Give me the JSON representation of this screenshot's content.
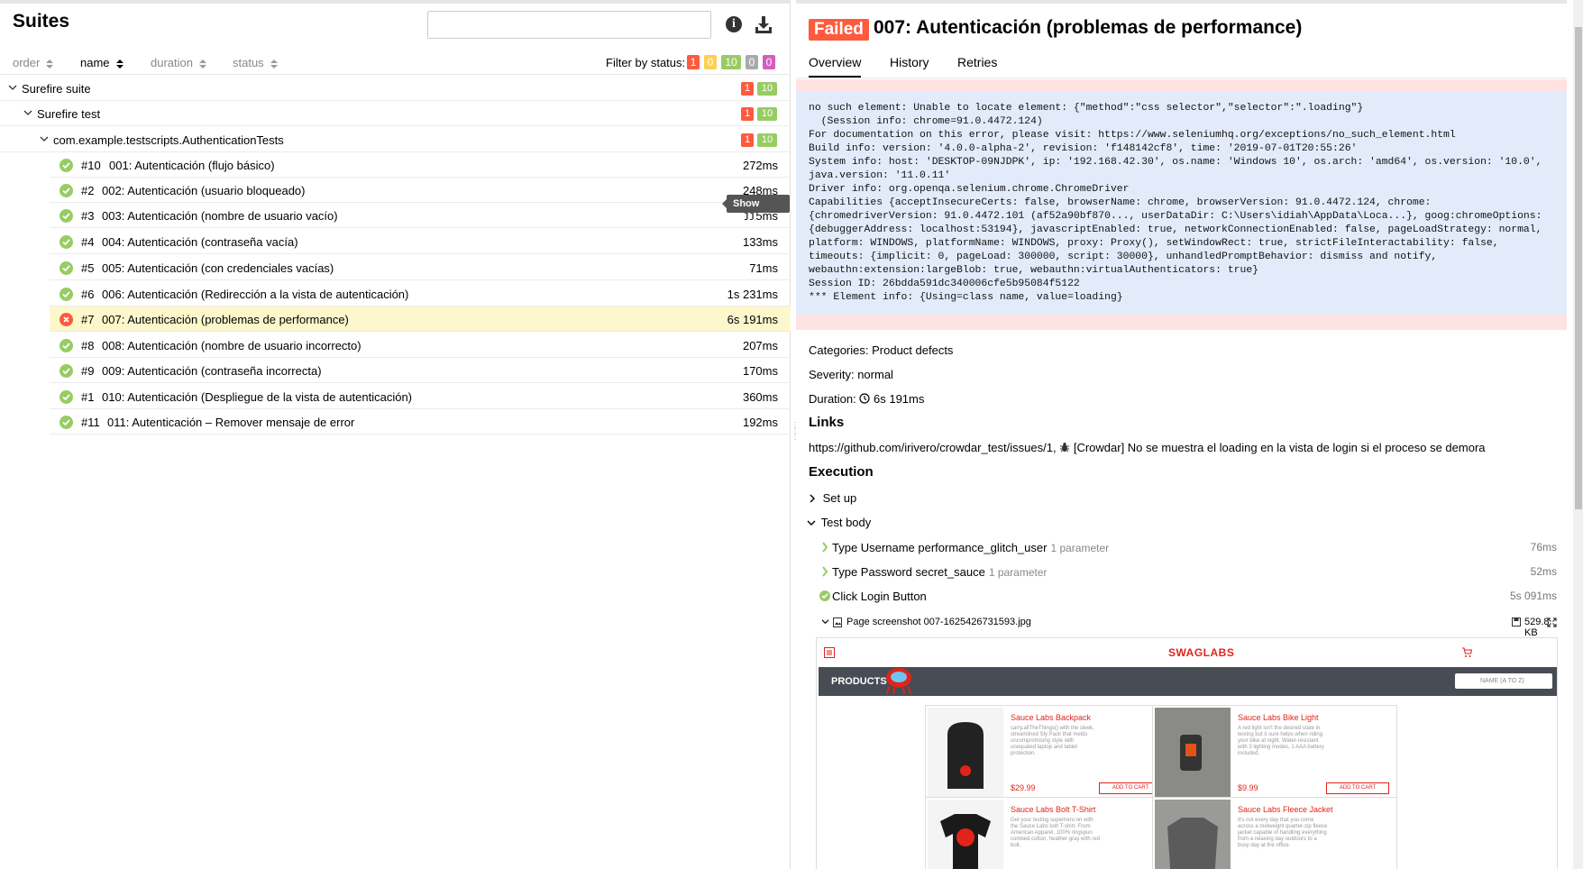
{
  "suites_panel": {
    "title": "Suites",
    "search_placeholder": "",
    "sort": [
      {
        "label": "order"
      },
      {
        "label": "name"
      },
      {
        "label": "duration"
      },
      {
        "label": "status"
      }
    ],
    "filter_label": "Filter by status:",
    "filter_badges": [
      {
        "count": "1",
        "color": "#fd5a3e"
      },
      {
        "count": "0",
        "color": "#ffd050"
      },
      {
        "count": "10",
        "color": "#97cc64"
      },
      {
        "count": "0",
        "color": "#aaaaaa"
      },
      {
        "count": "0",
        "color": "#d35ebe"
      }
    ],
    "tree": [
      {
        "label": "Surefire suite",
        "failed": "1",
        "passed": "10"
      },
      {
        "label": "Surefire test",
        "failed": "1",
        "passed": "10"
      },
      {
        "label": "com.example.testscripts.AuthenticationTests",
        "failed": "1",
        "passed": "10"
      }
    ],
    "tests": [
      {
        "num": "#10",
        "name": "001: Autenticación (flujo básico)",
        "duration": "272ms",
        "status": "passed"
      },
      {
        "num": "#2",
        "name": "002: Autenticación (usuario bloqueado)",
        "duration": "248ms",
        "status": "passed"
      },
      {
        "num": "#3",
        "name": "003: Autenticación (nombre de usuario vacío)",
        "duration": "115ms",
        "status": "passed"
      },
      {
        "num": "#4",
        "name": "004: Autenticación (contraseña vacía)",
        "duration": "133ms",
        "status": "passed"
      },
      {
        "num": "#5",
        "name": "005: Autenticación (con credenciales vacías)",
        "duration": "71ms",
        "status": "passed"
      },
      {
        "num": "#6",
        "name": "006: Autenticación (Redirección a la vista de autenticación)",
        "duration": "1s 231ms",
        "status": "passed"
      },
      {
        "num": "#7",
        "name": "007: Autenticación (problemas de performance)",
        "duration": "6s 191ms",
        "status": "failed"
      },
      {
        "num": "#8",
        "name": "008: Autenticación (nombre de usuario incorrecto)",
        "duration": "207ms",
        "status": "passed"
      },
      {
        "num": "#9",
        "name": "009: Autenticación (contraseña incorrecta)",
        "duration": "170ms",
        "status": "passed"
      },
      {
        "num": "#1",
        "name": "010: Autenticación (Despliegue de la vista de autenticación)",
        "duration": "360ms",
        "status": "passed"
      },
      {
        "num": "#11",
        "name": "011: Autenticación – Remover mensaje de error",
        "duration": "192ms",
        "status": "passed"
      }
    ],
    "tooltip": "Show trace"
  },
  "detail": {
    "status": "Failed",
    "title": "007: Autenticación (problemas de performance)",
    "tabs": [
      "Overview",
      "History",
      "Retries"
    ],
    "trace": "no such element: Unable to locate element: {\"method\":\"css selector\",\"selector\":\".loading\"}\n  (Session info: chrome=91.0.4472.124)\nFor documentation on this error, please visit: https://www.seleniumhq.org/exceptions/no_such_element.html\nBuild info: version: '4.0.0-alpha-2', revision: 'f148142cf8', time: '2019-07-01T20:55:26'\nSystem info: host: 'DESKTOP-09NJDPK', ip: '192.168.42.30', os.name: 'Windows 10', os.arch: 'amd64', os.version: '10.0',\njava.version: '11.0.11'\nDriver info: org.openqa.selenium.chrome.ChromeDriver\nCapabilities {acceptInsecureCerts: false, browserName: chrome, browserVersion: 91.0.4472.124, chrome:\n{chromedriverVersion: 91.0.4472.101 (af52a90bf870..., userDataDir: C:\\Users\\idiah\\AppData\\Loca...}, goog:chromeOptions:\n{debuggerAddress: localhost:53194}, javascriptEnabled: true, networkConnectionEnabled: false, pageLoadStrategy: normal,\nplatform: WINDOWS, platformName: WINDOWS, proxy: Proxy(), setWindowRect: true, strictFileInteractability: false,\ntimeouts: {implicit: 0, pageLoad: 300000, script: 30000}, unhandledPromptBehavior: dismiss and notify,\nwebauthn:extension:largeBlob: true, webauthn:virtualAuthenticators: true}\nSession ID: 26bdda591dc340006cfe5b95084f5122\n*** Element info: {Using=class name, value=loading}",
    "categories_label": "Categories:",
    "categories_value": "Product defects",
    "severity_label": "Severity:",
    "severity_value": "normal",
    "duration_label": "Duration:",
    "duration_value": "6s 191ms",
    "links_heading": "Links",
    "link_url": "https://github.com/irivero/crowdar_test/issues/1",
    "link_sep": ",",
    "link_issue": "[Crowdar] No se muestra el loading en la vista de login si el proceso se demora",
    "execution_heading": "Execution",
    "setup_label": "Set up",
    "testbody_label": "Test body",
    "steps": [
      {
        "name": "Type Username performance_glitch_user",
        "param": "1 parameter",
        "duration": "76ms"
      },
      {
        "name": "Type Password secret_sauce",
        "param": "1 parameter",
        "duration": "52ms"
      },
      {
        "name": "Click Login Button",
        "param": "",
        "duration": "5s 091ms"
      }
    ],
    "attachment_name": "Page screenshot 007-1625426731593.jpg",
    "attachment_size": "529.8 KB"
  },
  "screenshot": {
    "logo": "SWAGLABS",
    "products_label": "PRODUCTS",
    "sort_label": "NAME (A TO Z)",
    "items": [
      {
        "title": "Sauce Labs Backpack",
        "desc": "carry.allTheThings() with the sleek, streamlined Sly Pack that melds uncompromising style with unequaled laptop and tablet protection.",
        "price": "$29.99",
        "button": "ADD TO CART"
      },
      {
        "title": "Sauce Labs Bike Light",
        "desc": "A red light isn't the desired state in testing but it sure helps when riding your bike at night. Water-resistant with 3 lighting modes, 1 AAA battery included.",
        "price": "$9.99",
        "button": "ADD TO CART"
      },
      {
        "title": "Sauce Labs Bolt T-Shirt",
        "desc": "Get your testing superhero on with the Sauce Labs bolt T-shirt. From American Apparel, 100% ringspun combed cotton, heather gray with red bolt.",
        "price": "",
        "button": ""
      },
      {
        "title": "Sauce Labs Fleece Jacket",
        "desc": "It's not every day that you come across a midweight quarter-zip fleece jacket capable of handling everything from a relaxing day outdoors to a busy day at the office.",
        "price": "",
        "button": ""
      }
    ]
  },
  "colors": {
    "failed": "#fd5a3e",
    "broken": "#ffd050",
    "passed": "#97cc64",
    "skipped": "#aaaaaa",
    "unknown": "#d35ebe",
    "brand_red": "#e2231a"
  }
}
